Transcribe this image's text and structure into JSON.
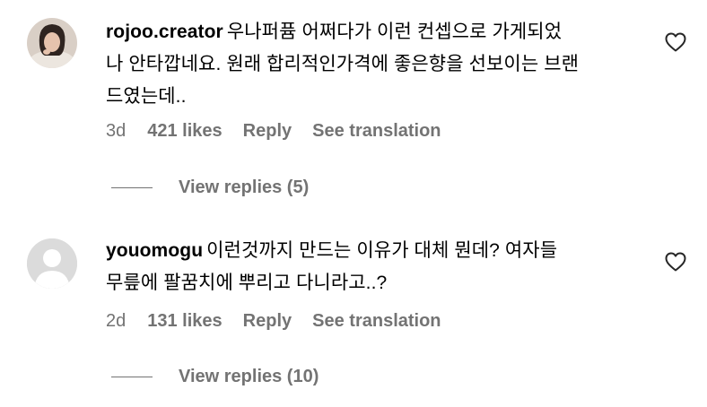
{
  "comments": [
    {
      "username": "rojoo.creator",
      "lines": [
        "우나퍼퓸 어쩌다가 이런 컨셉으로 가게되었",
        "나 안타깝네요. 원래 합리적인가격에 좋은향을 선보이는 브랜",
        "드였는데.."
      ],
      "time": "3d",
      "likes": "421 likes",
      "reply_label": "Reply",
      "translate_label": "See translation",
      "view_replies": "View replies (5)",
      "avatar": "profile-photo",
      "like_icon": "heart-outline-icon"
    },
    {
      "username": "youomogu",
      "lines": [
        "이런것까지 만드는 이유가 대체 뭔데? 여자들",
        "무릎에 팔꿈치에 뿌리고 다니라고..?"
      ],
      "time": "2d",
      "likes": "131 likes",
      "reply_label": "Reply",
      "translate_label": "See translation",
      "view_replies": "View replies (10)",
      "avatar": "default-avatar-icon",
      "like_icon": "heart-outline-icon"
    }
  ],
  "colors": {
    "text": "#000000",
    "secondary": "#737373",
    "avatar_placeholder": "#dbdbdb",
    "background": "#ffffff"
  }
}
